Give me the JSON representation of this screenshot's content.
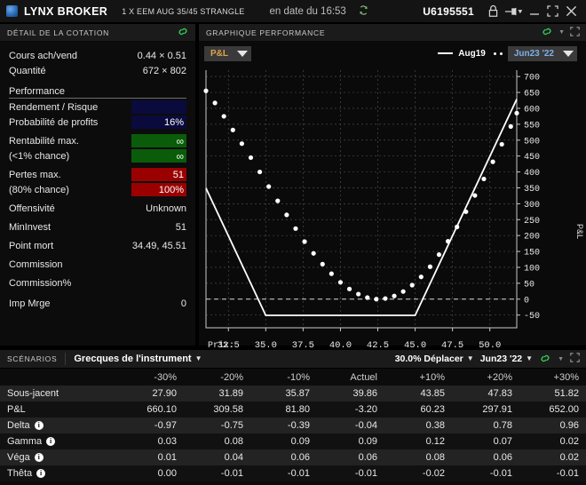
{
  "titlebar": {
    "brand": "LYNX BROKER",
    "contract": "1 X EEM AUG 35/45 STRANGLE",
    "time_label": "en date du 16:53",
    "refresh_icon": "refresh-icon",
    "account": "U6195551",
    "lock_icon": "lock-icon",
    "pin_icon": "pin-icon",
    "minimize_icon": "minimize-icon",
    "maximize_icon": "maximize-icon",
    "close_icon": "close-icon"
  },
  "quote_detail": {
    "panel_title": "DÉTAIL DE LA COTATION",
    "link_icon": "chain-link-icon",
    "rows": [
      {
        "label": "Cours ach/vend",
        "value": "0.44 × 0.51"
      },
      {
        "label": "Quantité",
        "value": "672 × 802"
      }
    ],
    "performance_header": "Performance",
    "perf": {
      "rendement_label": "Rendement / Risque",
      "rendement_value": "",
      "proba_label": "Probabilité de profits",
      "proba_value": "16%",
      "rentabilite_label": "Rentabilité max.",
      "rentabilite_value": "∞",
      "rentabilite_sub_label": "(<1% chance)",
      "rentabilite_sub_value": "∞",
      "pertes_label": "Pertes max.",
      "pertes_value": "51",
      "pertes_sub_label": "(80% chance)",
      "pertes_sub_value": "100%"
    },
    "rows2": [
      {
        "label": "Offensivité",
        "value": "Unknown"
      },
      {
        "label": "MinInvest",
        "value": "51"
      },
      {
        "label": "Point mort",
        "value": "34.49, 45.51"
      },
      {
        "label": "Commission",
        "value": ""
      },
      {
        "label": "Commission%",
        "value": ""
      },
      {
        "label": "Imp Mrge",
        "value": "0"
      }
    ],
    "colors": {
      "navy": "#0a0a3c",
      "green": "#0a5c0a",
      "red": "#9a0000"
    }
  },
  "chart": {
    "panel_title": "GRAPHIQUE PERFORMANCE",
    "link_icon": "chain-link-icon",
    "caret_icon": "chevron-down-icon",
    "expand_icon": "expand-icon",
    "metric_dropdown": "P&L",
    "date_dropdown": "Jun23 '22",
    "legend_solid": "Aug19",
    "legend_dotted": "Jun23 '22",
    "x_axis_prefix": "Prix:"
  },
  "chart_data": {
    "type": "line",
    "title": "GRAPHIQUE PERFORMANCE",
    "xlabel": "Prix:",
    "ylabel": "P&L",
    "xlim": [
      31.0,
      51.8
    ],
    "ylim": [
      -90,
      720
    ],
    "xticks": [
      "32.5",
      "35.0",
      "37.5",
      "40.0",
      "42.5",
      "45.0",
      "47.5",
      "50.0"
    ],
    "xtick_values": [
      32.5,
      35.0,
      37.5,
      40.0,
      42.5,
      45.0,
      47.5,
      50.0
    ],
    "yticks": [
      "700",
      "650",
      "600",
      "550",
      "500",
      "450",
      "400",
      "350",
      "300",
      "250",
      "200",
      "150",
      "100",
      "50",
      "0",
      "-50"
    ],
    "ytick_values": [
      700,
      650,
      600,
      550,
      500,
      450,
      400,
      350,
      300,
      250,
      200,
      150,
      100,
      50,
      0,
      -50
    ],
    "grid": true,
    "zero_line": 0,
    "legend_position": "top-right",
    "series": [
      {
        "name": "Aug19",
        "style": "solid",
        "color": "#ffffff",
        "x": [
          31.0,
          35.0,
          45.0,
          51.8
        ],
        "values": [
          349,
          -51,
          -51,
          629
        ]
      },
      {
        "name": "Jun23 '22",
        "style": "dotted",
        "color": "#ffffff",
        "x": [
          31.0,
          31.6,
          32.2,
          32.8,
          33.4,
          34.0,
          34.6,
          35.2,
          35.8,
          36.4,
          37.0,
          37.6,
          38.2,
          38.8,
          39.4,
          40.0,
          40.6,
          41.2,
          41.8,
          42.4,
          43.0,
          43.6,
          44.2,
          44.8,
          45.4,
          46.0,
          46.6,
          47.2,
          47.8,
          48.4,
          49.0,
          49.6,
          50.2,
          50.8,
          51.4,
          51.8
        ],
        "values": [
          655,
          617,
          575,
          532,
          489,
          445,
          400,
          354,
          309,
          265,
          222,
          181,
          144,
          110,
          80,
          53,
          32,
          16,
          5,
          0,
          2,
          10,
          24,
          44,
          70,
          102,
          140,
          182,
          227,
          275,
          326,
          378,
          432,
          487,
          543,
          585
        ]
      }
    ]
  },
  "scenarios": {
    "tag": "SCÉNARIOS",
    "selector": "Grecques de l'instrument",
    "caret_icon": "chevron-down-icon",
    "shift": "30.0% Déplacer",
    "date": "Jun23 '22",
    "link_icon": "chain-link-icon",
    "expand_icon": "expand-icon",
    "columns": [
      "",
      "-30%",
      "-20%",
      "-10%",
      "Actuel",
      "+10%",
      "+20%",
      "+30%"
    ],
    "rows": [
      {
        "label": "Sous-jacent",
        "info": false,
        "values": [
          "27.90",
          "31.89",
          "35.87",
          "39.86",
          "43.85",
          "47.83",
          "51.82"
        ]
      },
      {
        "label": "P&L",
        "info": false,
        "values": [
          "660.10",
          "309.58",
          "81.80",
          "-3.20",
          "60.23",
          "297.91",
          "652.00"
        ]
      },
      {
        "label": "Delta",
        "info": true,
        "values": [
          "-0.97",
          "-0.75",
          "-0.39",
          "-0.04",
          "0.38",
          "0.78",
          "0.96"
        ]
      },
      {
        "label": "Gamma",
        "info": true,
        "values": [
          "0.03",
          "0.08",
          "0.09",
          "0.09",
          "0.12",
          "0.07",
          "0.02"
        ]
      },
      {
        "label": "Véga",
        "info": true,
        "values": [
          "0.01",
          "0.04",
          "0.06",
          "0.06",
          "0.08",
          "0.06",
          "0.02"
        ]
      },
      {
        "label": "Thêta",
        "info": true,
        "values": [
          "0.00",
          "-0.01",
          "-0.01",
          "-0.01",
          "-0.02",
          "-0.01",
          "-0.01"
        ]
      }
    ],
    "info_glyph": "i"
  }
}
